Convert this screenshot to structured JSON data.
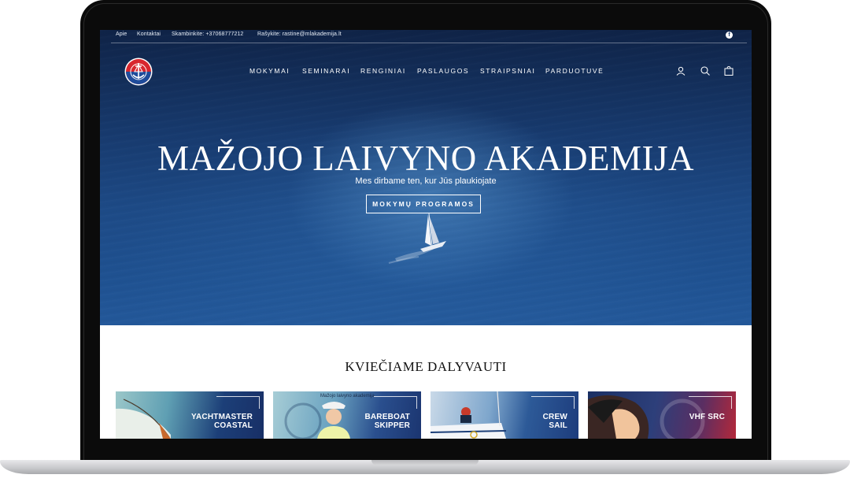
{
  "topbar": {
    "links": [
      "Apie",
      "Kontaktai"
    ],
    "phone": "Skambinkite: +37068777212",
    "email": "Rašykite: rastine@mlakademija.lt",
    "social_icon": "facebook-icon"
  },
  "nav": {
    "items": [
      "MOKYMAI",
      "SEMINARAI",
      "RENGINIAI",
      "PASLAUGOS",
      "STRAIPSNIAI",
      "PARDUOTUVĖ"
    ],
    "icons": [
      "account-icon",
      "search-icon",
      "cart-icon"
    ]
  },
  "hero": {
    "title": "MAŽOJO LAIVYNO AKADEMIJA",
    "subtitle": "Mes dirbame ten, kur Jūs plaukiojate",
    "cta": "MOKYMŲ PROGRAMOS"
  },
  "section": {
    "title": "KVIEČIAME DALYVAUTI"
  },
  "cards": [
    {
      "label": "YACHTMASTER\nCOASTAL",
      "caption": ""
    },
    {
      "label": "BAREBOAT\nSKIPPER",
      "caption": "Mažojo laivyno akademija"
    },
    {
      "label": "CREW\nSAIL",
      "caption": ""
    },
    {
      "label": "VHF SRC",
      "caption": ""
    }
  ],
  "colors": {
    "hero_top": "#0f2347",
    "hero_bottom": "#23589a",
    "frame": "#0b0b0b"
  }
}
